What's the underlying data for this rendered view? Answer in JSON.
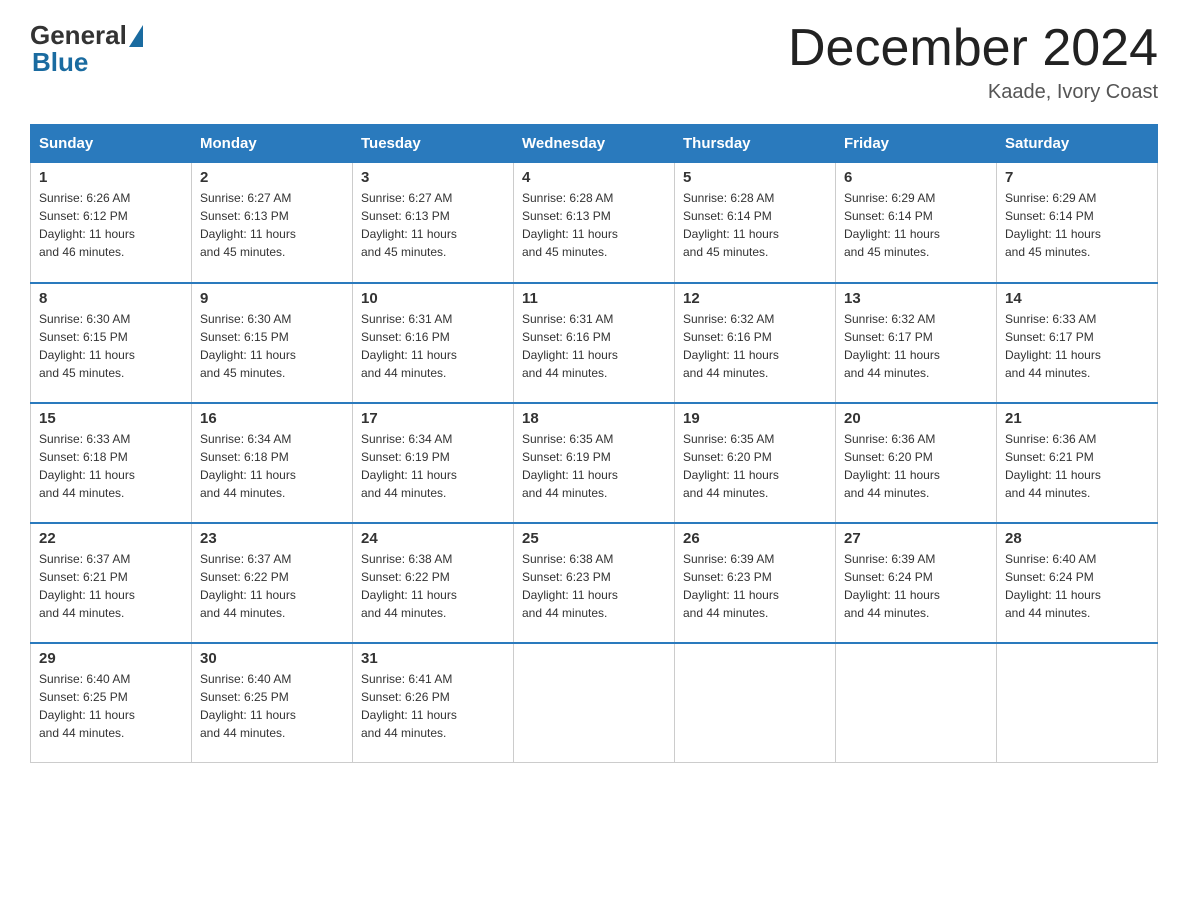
{
  "logo": {
    "general": "General",
    "blue": "Blue"
  },
  "title": "December 2024",
  "location": "Kaade, Ivory Coast",
  "weekdays": [
    "Sunday",
    "Monday",
    "Tuesday",
    "Wednesday",
    "Thursday",
    "Friday",
    "Saturday"
  ],
  "weeks": [
    [
      {
        "day": "1",
        "sunrise": "6:26 AM",
        "sunset": "6:12 PM",
        "daylight": "11 hours and 46 minutes."
      },
      {
        "day": "2",
        "sunrise": "6:27 AM",
        "sunset": "6:13 PM",
        "daylight": "11 hours and 45 minutes."
      },
      {
        "day": "3",
        "sunrise": "6:27 AM",
        "sunset": "6:13 PM",
        "daylight": "11 hours and 45 minutes."
      },
      {
        "day": "4",
        "sunrise": "6:28 AM",
        "sunset": "6:13 PM",
        "daylight": "11 hours and 45 minutes."
      },
      {
        "day": "5",
        "sunrise": "6:28 AM",
        "sunset": "6:14 PM",
        "daylight": "11 hours and 45 minutes."
      },
      {
        "day": "6",
        "sunrise": "6:29 AM",
        "sunset": "6:14 PM",
        "daylight": "11 hours and 45 minutes."
      },
      {
        "day": "7",
        "sunrise": "6:29 AM",
        "sunset": "6:14 PM",
        "daylight": "11 hours and 45 minutes."
      }
    ],
    [
      {
        "day": "8",
        "sunrise": "6:30 AM",
        "sunset": "6:15 PM",
        "daylight": "11 hours and 45 minutes."
      },
      {
        "day": "9",
        "sunrise": "6:30 AM",
        "sunset": "6:15 PM",
        "daylight": "11 hours and 45 minutes."
      },
      {
        "day": "10",
        "sunrise": "6:31 AM",
        "sunset": "6:16 PM",
        "daylight": "11 hours and 44 minutes."
      },
      {
        "day": "11",
        "sunrise": "6:31 AM",
        "sunset": "6:16 PM",
        "daylight": "11 hours and 44 minutes."
      },
      {
        "day": "12",
        "sunrise": "6:32 AM",
        "sunset": "6:16 PM",
        "daylight": "11 hours and 44 minutes."
      },
      {
        "day": "13",
        "sunrise": "6:32 AM",
        "sunset": "6:17 PM",
        "daylight": "11 hours and 44 minutes."
      },
      {
        "day": "14",
        "sunrise": "6:33 AM",
        "sunset": "6:17 PM",
        "daylight": "11 hours and 44 minutes."
      }
    ],
    [
      {
        "day": "15",
        "sunrise": "6:33 AM",
        "sunset": "6:18 PM",
        "daylight": "11 hours and 44 minutes."
      },
      {
        "day": "16",
        "sunrise": "6:34 AM",
        "sunset": "6:18 PM",
        "daylight": "11 hours and 44 minutes."
      },
      {
        "day": "17",
        "sunrise": "6:34 AM",
        "sunset": "6:19 PM",
        "daylight": "11 hours and 44 minutes."
      },
      {
        "day": "18",
        "sunrise": "6:35 AM",
        "sunset": "6:19 PM",
        "daylight": "11 hours and 44 minutes."
      },
      {
        "day": "19",
        "sunrise": "6:35 AM",
        "sunset": "6:20 PM",
        "daylight": "11 hours and 44 minutes."
      },
      {
        "day": "20",
        "sunrise": "6:36 AM",
        "sunset": "6:20 PM",
        "daylight": "11 hours and 44 minutes."
      },
      {
        "day": "21",
        "sunrise": "6:36 AM",
        "sunset": "6:21 PM",
        "daylight": "11 hours and 44 minutes."
      }
    ],
    [
      {
        "day": "22",
        "sunrise": "6:37 AM",
        "sunset": "6:21 PM",
        "daylight": "11 hours and 44 minutes."
      },
      {
        "day": "23",
        "sunrise": "6:37 AM",
        "sunset": "6:22 PM",
        "daylight": "11 hours and 44 minutes."
      },
      {
        "day": "24",
        "sunrise": "6:38 AM",
        "sunset": "6:22 PM",
        "daylight": "11 hours and 44 minutes."
      },
      {
        "day": "25",
        "sunrise": "6:38 AM",
        "sunset": "6:23 PM",
        "daylight": "11 hours and 44 minutes."
      },
      {
        "day": "26",
        "sunrise": "6:39 AM",
        "sunset": "6:23 PM",
        "daylight": "11 hours and 44 minutes."
      },
      {
        "day": "27",
        "sunrise": "6:39 AM",
        "sunset": "6:24 PM",
        "daylight": "11 hours and 44 minutes."
      },
      {
        "day": "28",
        "sunrise": "6:40 AM",
        "sunset": "6:24 PM",
        "daylight": "11 hours and 44 minutes."
      }
    ],
    [
      {
        "day": "29",
        "sunrise": "6:40 AM",
        "sunset": "6:25 PM",
        "daylight": "11 hours and 44 minutes."
      },
      {
        "day": "30",
        "sunrise": "6:40 AM",
        "sunset": "6:25 PM",
        "daylight": "11 hours and 44 minutes."
      },
      {
        "day": "31",
        "sunrise": "6:41 AM",
        "sunset": "6:26 PM",
        "daylight": "11 hours and 44 minutes."
      },
      null,
      null,
      null,
      null
    ]
  ],
  "labels": {
    "sunrise": "Sunrise:",
    "sunset": "Sunset:",
    "daylight": "Daylight:"
  }
}
